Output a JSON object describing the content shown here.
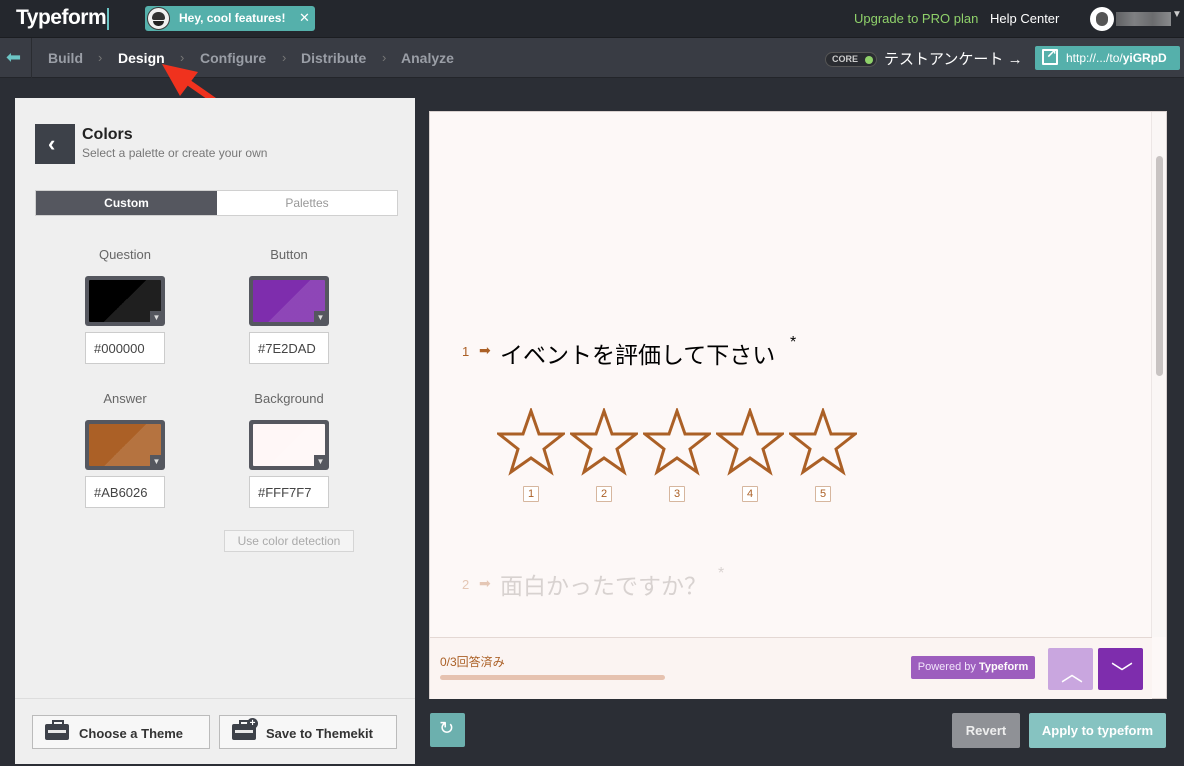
{
  "topbar": {
    "logo": "Typeform",
    "promo_text": "Hey, cool features!",
    "promo_close": "✕",
    "upgrade_label": "Upgrade to PRO plan",
    "help_label": "Help Center"
  },
  "nav": {
    "items": [
      "Build",
      "Design",
      "Configure",
      "Distribute",
      "Analyze"
    ],
    "active": "Design",
    "separator": "›",
    "core_badge": "CORE",
    "form_title": "テストアンケート →",
    "url_prefix": "http://.../to/",
    "url_id": "yiGRpD"
  },
  "colors_panel": {
    "title": "Colors",
    "subtitle": "Select a palette or create your own",
    "tabs": [
      "Custom",
      "Palettes"
    ],
    "active_tab": "Custom",
    "swatches": [
      {
        "label": "Question",
        "value": "#000000",
        "color": "#000000"
      },
      {
        "label": "Button",
        "value": "#7E2DAD",
        "color": "#7E2DAD"
      },
      {
        "label": "Answer",
        "value": "#AB6026",
        "color": "#AB6026"
      },
      {
        "label": "Background",
        "value": "#FFF7F7",
        "color": "#FFF7F7"
      }
    ],
    "color_detection_label": "Use color detection",
    "choose_theme_label": "Choose a Theme",
    "save_theme_label": "Save to Themekit"
  },
  "preview": {
    "q1_number": "1",
    "q1_text": "イベントを評価して下さい",
    "required_mark": "*",
    "rating_options": [
      "1",
      "2",
      "3",
      "4",
      "5"
    ],
    "q2_number": "2",
    "q2_text": "面白かったですか？",
    "progress_text": "0/3回答済み",
    "powered_prefix": "Powered by ",
    "powered_brand": "Typeform"
  },
  "actions": {
    "revert_label": "Revert",
    "apply_label": "Apply to typeform"
  },
  "icons": {
    "nav_back": "back-arrow-icon",
    "panel_back": "chevron-left-icon",
    "star": "star-outline-icon",
    "refresh": "refresh-icon",
    "external_link": "external-link-icon"
  },
  "accent_colors": {
    "teal": "#55b0ab",
    "upgrade_green": "#8fd16a",
    "button_purple": "#7E2DAD",
    "answer_brown": "#AB6026"
  }
}
